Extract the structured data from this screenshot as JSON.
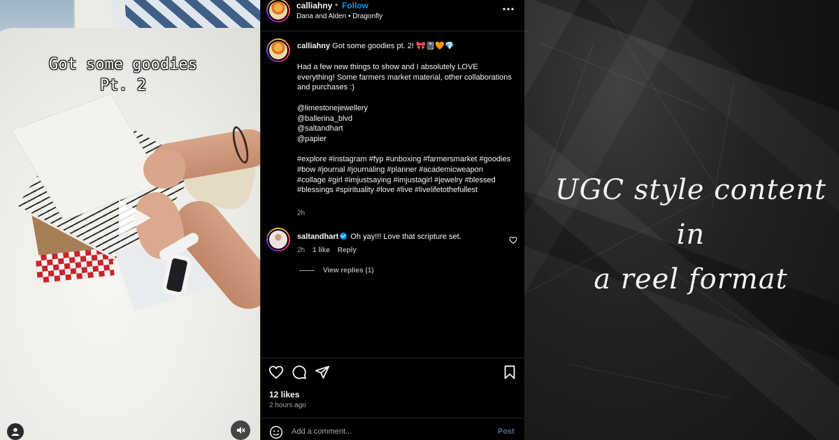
{
  "video": {
    "overlay_text": "Got some goodies\nPt. 2"
  },
  "post": {
    "author": "calliahny",
    "follow_label": "Follow",
    "separator": "•",
    "audio": "Dana and Alden • Dragonfly",
    "caption_head": "Got some goodies pt. 2! 🎀📓🧡💎",
    "caption_body": "Had a few new things to show and I absolutely LOVE everything! Some farmers market material, other collaborations and purchases :)\n\n@limestonejewellery\n@ballerina_blvd\n@saltandhart\n@papier\n\n#explore #instagram #fyp #unboxing #farmersmarket #goodies #bow #journal #journaling #planner #academicweapon #collage #girl #imjustsaying #imjustagirl #jewelry #blessed #blessings #spirituality #love #live #livelifetothefullest",
    "caption_time": "2h"
  },
  "comment": {
    "author": "saltandhart",
    "text": "Oh yay!!! Love that scripture set.",
    "time": "2h",
    "likes": "1 like",
    "reply_label": "Reply",
    "view_replies": "View replies (1)"
  },
  "footer": {
    "likes": "12 likes",
    "posted": "2 hours ago",
    "comment_placeholder": "Add a comment...",
    "post_label": "Post"
  },
  "tagline": "UGC style content in\na reel format",
  "colors": {
    "panel_bg": "#000000",
    "accent_blue": "#0095f6",
    "muted_text": "#a8a8a8"
  }
}
